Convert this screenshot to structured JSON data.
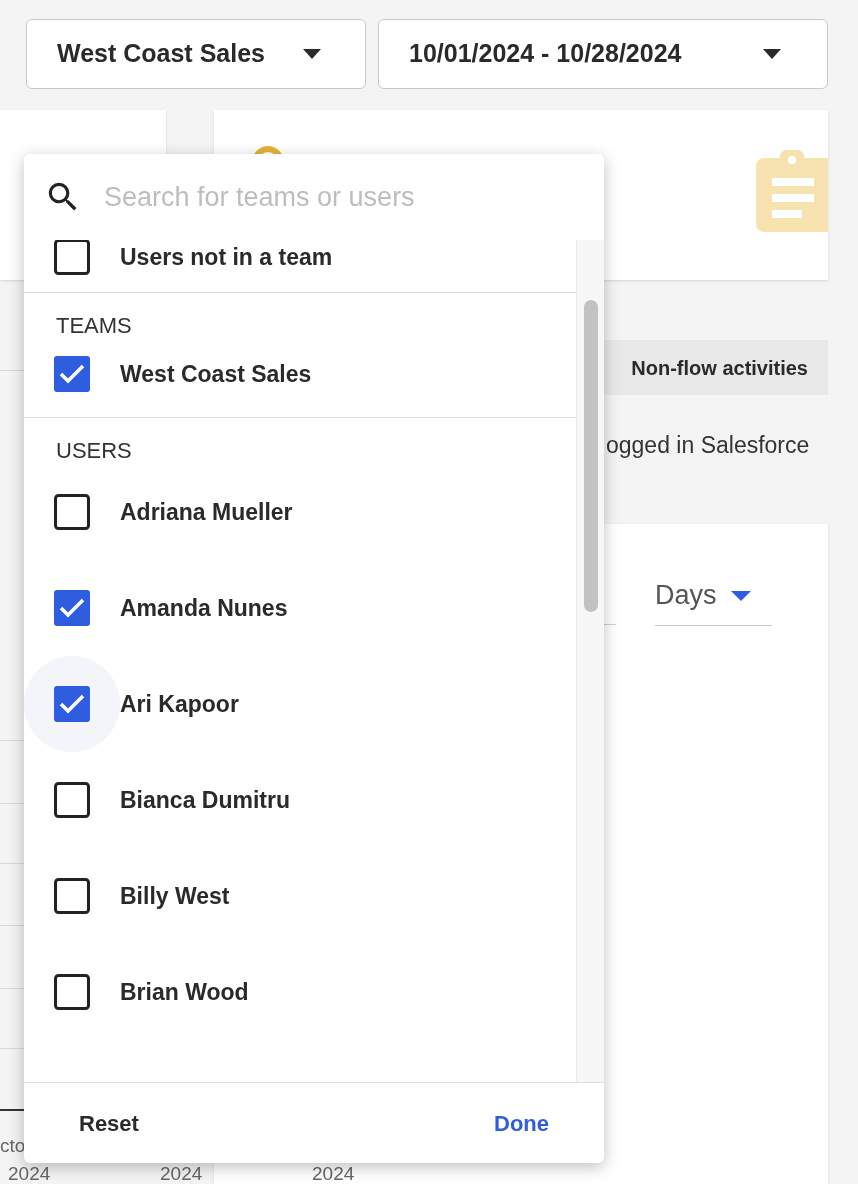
{
  "filters": {
    "team_dropdown": "West Coast Sales",
    "date_dropdown": "10/01/2024 - 10/28/2024"
  },
  "background": {
    "chip": "Non-flow activities",
    "caption": "ogged in Salesforce",
    "period_dropdown": "Days",
    "x_labels": [
      {
        "lines": [
          "cto",
          "2024"
        ]
      },
      {
        "lines": [
          "2024"
        ]
      },
      {
        "lines": [
          "2024"
        ]
      }
    ]
  },
  "picker": {
    "search": {
      "placeholder": "Search for teams or users"
    },
    "sections": [
      {
        "items": [
          {
            "label": "Users not in a team",
            "checked": false,
            "focused": false
          }
        ]
      },
      {
        "heading": "TEAMS",
        "items": [
          {
            "label": "West Coast Sales",
            "checked": true,
            "focused": false
          }
        ]
      },
      {
        "heading": "USERS",
        "items": [
          {
            "label": "Adriana Mueller",
            "checked": false,
            "focused": false
          },
          {
            "label": "Amanda Nunes",
            "checked": true,
            "focused": false
          },
          {
            "label": "Ari Kapoor",
            "checked": true,
            "focused": true
          },
          {
            "label": "Bianca Dumitru",
            "checked": false,
            "focused": false
          },
          {
            "label": "Billy West",
            "checked": false,
            "focused": false
          },
          {
            "label": "Brian Wood",
            "checked": false,
            "focused": false
          }
        ]
      }
    ],
    "buttons": {
      "reset": "Reset",
      "done": "Done"
    }
  }
}
